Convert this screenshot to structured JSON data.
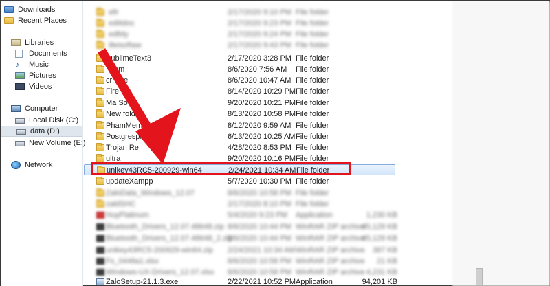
{
  "sidebar": {
    "favorites": [
      {
        "label": "Downloads",
        "icon": "downloads-folder-icon"
      },
      {
        "label": "Recent Places",
        "icon": "recent-places-icon"
      }
    ],
    "libraries_label": "Libraries",
    "libraries": [
      {
        "label": "Documents",
        "icon": "documents-icon"
      },
      {
        "label": "Music",
        "icon": "music-icon"
      },
      {
        "label": "Pictures",
        "icon": "pictures-icon"
      },
      {
        "label": "Videos",
        "icon": "videos-icon"
      }
    ],
    "computer_label": "Computer",
    "drives": [
      {
        "label": "Local Disk (C:)",
        "selected": false
      },
      {
        "label": "data (D:)",
        "selected": true
      },
      {
        "label": "New Volume (E:)",
        "selected": false
      }
    ],
    "network_label": "Network"
  },
  "files": [
    {
      "name": "SublimeText3",
      "date": "2/17/2020 3:28 PM",
      "type": "File folder",
      "size": "",
      "kind": "folder",
      "partial_name": true
    },
    {
      "name": "om",
      "date": "8/6/2020 7:56 AM",
      "type": "File folder",
      "size": "",
      "kind": "folder",
      "partial_name": true
    },
    {
      "name": "cr ffice",
      "date": "8/6/2020 10:47 AM",
      "type": "File folder",
      "size": "",
      "kind": "folder",
      "partial_name": true
    },
    {
      "name": "Fire",
      "date": "8/14/2020 10:29 PM",
      "type": "File folder",
      "size": "",
      "kind": "folder",
      "partial_name": true
    },
    {
      "name": "Ma So",
      "date": "9/20/2020 10:21 PM",
      "type": "File folder",
      "size": "",
      "kind": "folder",
      "partial_name": true
    },
    {
      "name": "New fold",
      "date": "8/13/2020 10:58 PM",
      "type": "File folder",
      "size": "",
      "kind": "folder",
      "partial_name": true
    },
    {
      "name": "PhamMem",
      "date": "8/12/2020 9:59 AM",
      "type": "File folder",
      "size": "",
      "kind": "folder",
      "partial_name": true
    },
    {
      "name": "Postgrespl",
      "date": "6/13/2020 10:25 AM",
      "type": "File folder",
      "size": "",
      "kind": "folder",
      "partial_name": true
    },
    {
      "name": "Trojan Re",
      "date": "4/28/2020 8:53 PM",
      "type": "File folder",
      "size": "",
      "kind": "folder",
      "partial_name": true
    },
    {
      "name": "ultra",
      "date": "9/20/2020 10:16 PM",
      "type": "File folder",
      "size": "",
      "kind": "folder",
      "partial_name": false
    },
    {
      "name": "unikey43RC5-200929-win64",
      "date": "2/24/2021 10:34 AM",
      "type": "File folder",
      "size": "",
      "kind": "folder",
      "selected": true
    },
    {
      "name": "updateXampp",
      "date": "5/7/2020 10:30 PM",
      "type": "File folder",
      "size": "",
      "kind": "folder"
    },
    {
      "name": "ZaloSetup-21.1.3.exe",
      "date": "2/22/2021 10:52 PM",
      "type": "Application",
      "size": "94,201 KB",
      "kind": "app"
    }
  ],
  "right_sizes": [
    "94,201 KB"
  ],
  "colors": {
    "highlight": "#e4141c",
    "selection_bg": "#d3e6fb",
    "selection_border": "#84acdd",
    "folder": "#e9bb3f"
  }
}
